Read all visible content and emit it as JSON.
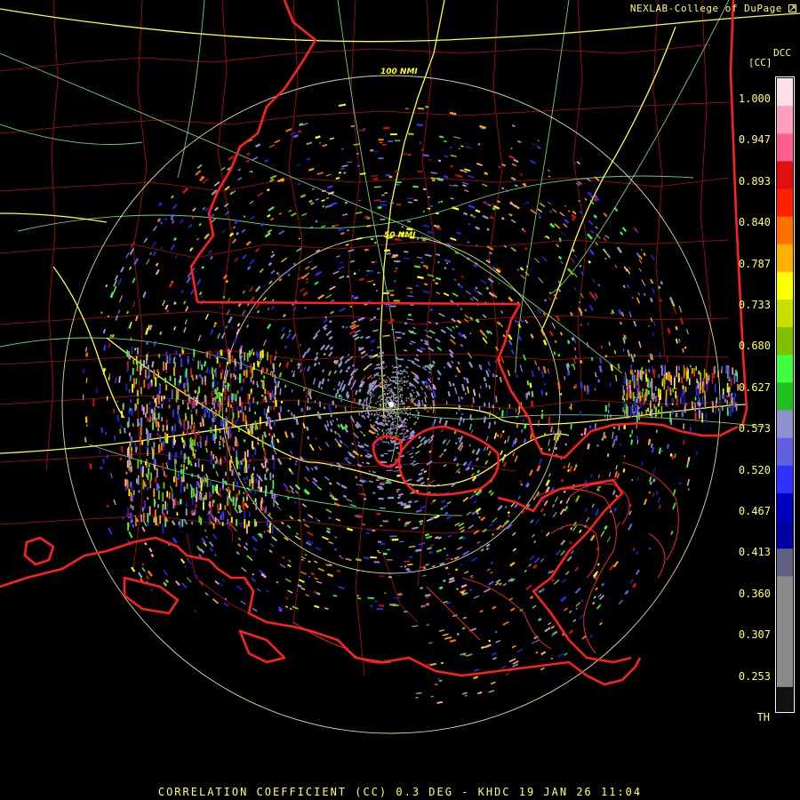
{
  "header": {
    "credit": "NEXLAB-College of DuPage",
    "credit_icon": "expand-arrow-icon",
    "product_code": "DCC",
    "unit": "[CC]"
  },
  "legend": {
    "labels": [
      "1.000",
      "0.947",
      "0.893",
      "0.840",
      "0.787",
      "0.733",
      "0.680",
      "0.627",
      "0.573",
      "0.520",
      "0.467",
      "0.413",
      "0.360",
      "0.307",
      "0.253",
      "TH"
    ],
    "colors": [
      "#ffe0e8",
      "#ff9fc0",
      "#ff6090",
      "#e01010",
      "#ff2000",
      "#ff7000",
      "#ffb000",
      "#ffff00",
      "#c8e000",
      "#80c000",
      "#40ff40",
      "#20c020",
      "#9090d0",
      "#6060e0",
      "#3030ff",
      "#0000c0",
      "#0000a0",
      "#606080",
      "#8a8a8a",
      "#8a8a8a",
      "#8a8a8a",
      "#8a8a8a",
      "#111111"
    ]
  },
  "map": {
    "range_rings": [
      "100 NMI",
      "50 NMI"
    ],
    "colors": {
      "state_boundary": "#ff2020",
      "county_boundary": "#b01010",
      "highway": "#ffff40",
      "road": "#70d070",
      "ring": "#ffffaa"
    }
  },
  "footer": {
    "title": "CORRELATION COEFFICIENT (CC) 0.3 DEG - KHDC 19 JAN 26 11:04"
  }
}
